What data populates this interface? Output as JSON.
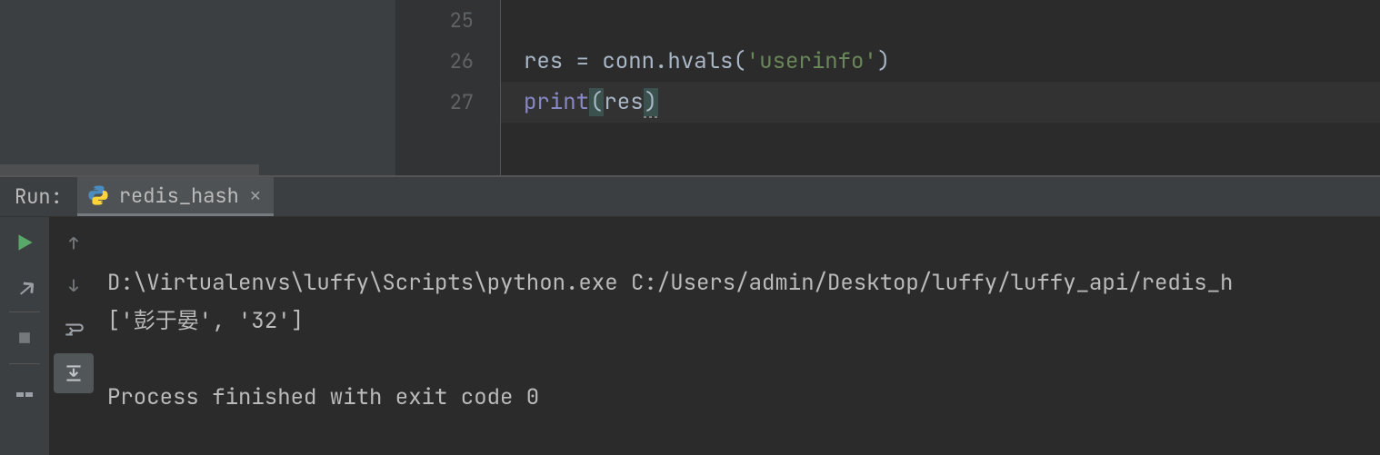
{
  "editor": {
    "lines": {
      "n25": "25",
      "n26": "26",
      "n27": "27"
    },
    "code": {
      "l26_var": "res",
      "l26_eq": " = ",
      "l26_conn": "conn",
      "l26_dot": ".",
      "l26_fn": "hvals",
      "l26_p0": "(",
      "l26_str": "'userinfo'",
      "l26_p1": ")",
      "l27_fn": "print",
      "l27_p0": "(",
      "l27_arg": "res",
      "l27_p1": ")"
    }
  },
  "run": {
    "label": "Run:",
    "tab_name": "redis_hash",
    "console_line1": "D:\\Virtualenvs\\luffy\\Scripts\\python.exe C:/Users/admin/Desktop/luffy/luffy_api/redis_h",
    "console_line2": "['彭于晏', '32']",
    "console_blank": "",
    "console_line3": "Process finished with exit code 0"
  }
}
